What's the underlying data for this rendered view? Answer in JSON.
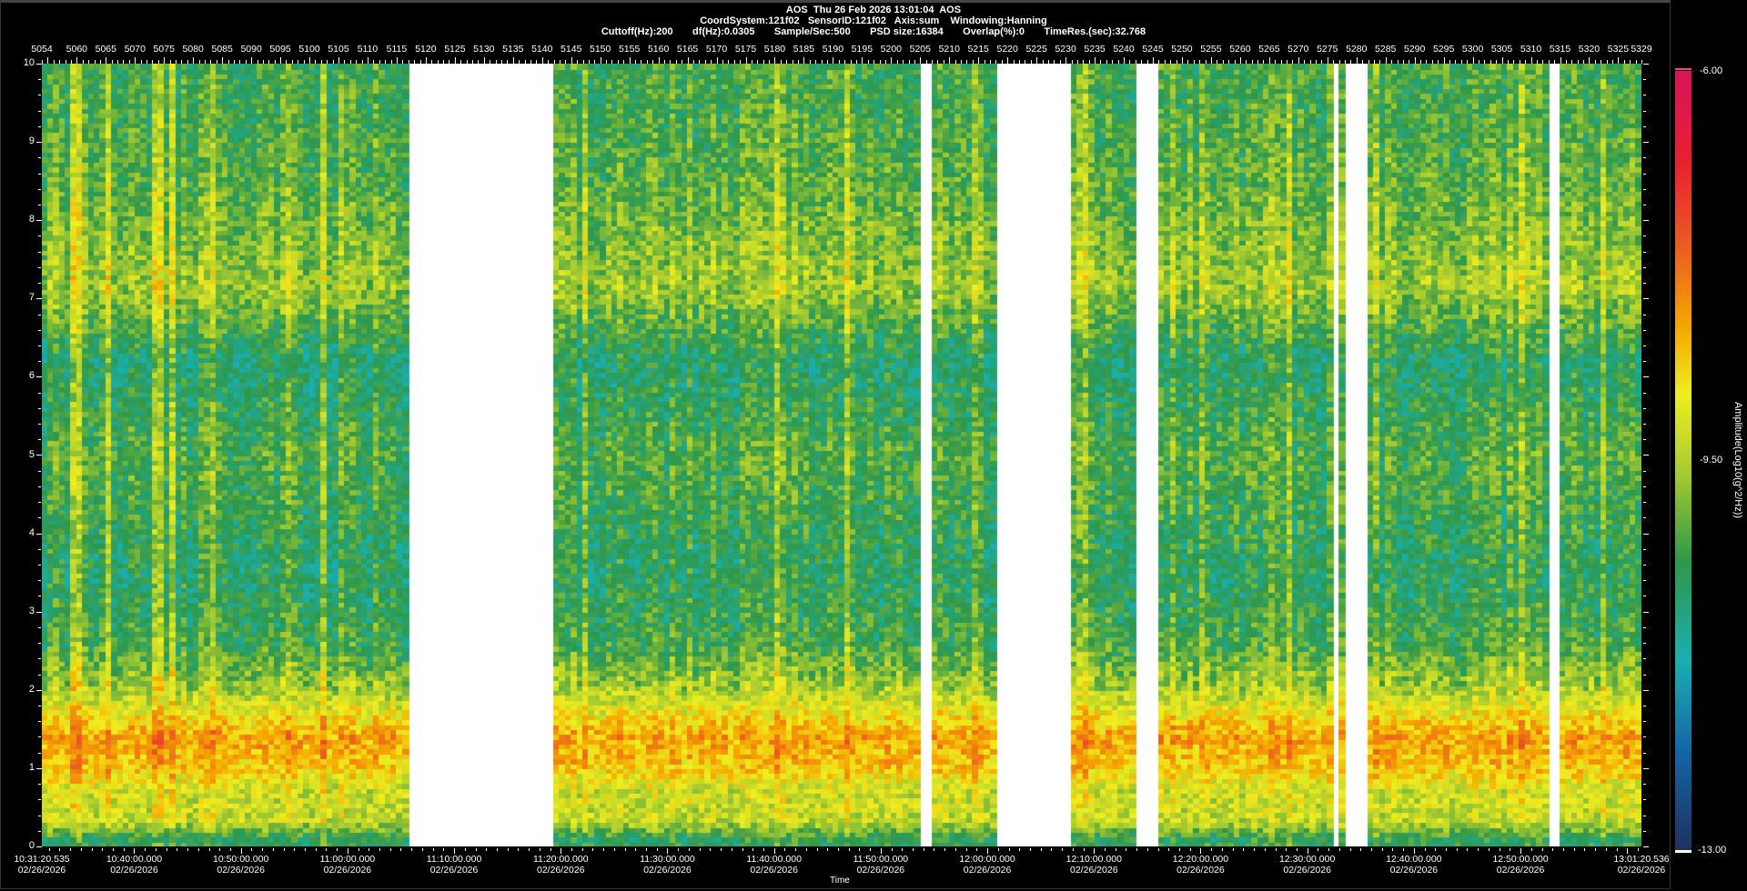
{
  "header": {
    "title": "AOS  Thu 26 Feb 2026 13:01:04  AOS",
    "line2": "CoordSystem:121f02   SensorID:121f02   Axis:sum    Windowing:Hanning",
    "line3": "Cuttoff(Hz):200       df(Hz):0.0305       Sample/Sec:500       PSD size:16384       Overlap(%):0       TimeRes.(sec):32.768"
  },
  "chart_data": {
    "type": "heatmap",
    "xlabel": "Time",
    "ylabel": "",
    "ylim": [
      0,
      10
    ],
    "yticks": [
      "0",
      "1",
      "2",
      "3",
      "4",
      "5",
      "6",
      "7",
      "8",
      "9",
      "10"
    ],
    "x_start": "10:31:20.535",
    "x_end": "13:01:20.536",
    "xticks": [
      {
        "time": "10:31:20.535",
        "date": "02/26/2026"
      },
      {
        "time": "10:40:00.000",
        "date": "02/26/2026"
      },
      {
        "time": "10:50:00.000",
        "date": "02/26/2026"
      },
      {
        "time": "11:00:00.000",
        "date": "02/26/2026"
      },
      {
        "time": "11:10:00.000",
        "date": "02/26/2026"
      },
      {
        "time": "11:20:00.000",
        "date": "02/26/2026"
      },
      {
        "time": "11:30:00.000",
        "date": "02/26/2026"
      },
      {
        "time": "11:40:00.000",
        "date": "02/26/2026"
      },
      {
        "time": "11:50:00.000",
        "date": "02/26/2026"
      },
      {
        "time": "12:00:00.000",
        "date": "02/26/2026"
      },
      {
        "time": "12:10:00.000",
        "date": "02/26/2026"
      },
      {
        "time": "12:20:00.000",
        "date": "02/26/2026"
      },
      {
        "time": "12:30:00.000",
        "date": "02/26/2026"
      },
      {
        "time": "12:40:00.000",
        "date": "02/26/2026"
      },
      {
        "time": "12:50:00.000",
        "date": "02/26/2026"
      },
      {
        "time": "13:01:20.536",
        "date": "02/26/2026"
      }
    ],
    "top_axis": {
      "start": 5054,
      "end": 5329,
      "labels": [
        "5054",
        "5060",
        "5065",
        "5070",
        "5075",
        "5080",
        "5085",
        "5090",
        "5095",
        "5100",
        "5105",
        "5110",
        "5115",
        "5120",
        "5125",
        "5130",
        "5135",
        "5140",
        "5145",
        "5150",
        "5155",
        "5160",
        "5165",
        "5170",
        "5175",
        "5180",
        "5185",
        "5190",
        "5195",
        "5200",
        "5205",
        "5210",
        "5215",
        "5220",
        "5225",
        "5230",
        "5235",
        "5240",
        "5245",
        "5250",
        "5255",
        "5260",
        "5265",
        "5270",
        "5275",
        "5280",
        "5285",
        "5290",
        "5295",
        "5300",
        "5305",
        "5310",
        "5315",
        "5320",
        "5325",
        "5329"
      ]
    },
    "gaps": [
      [
        "11:05:38",
        "11:19:14"
      ],
      [
        "11:53:38",
        "11:54:44"
      ],
      [
        "12:00:56",
        "12:08:14"
      ],
      [
        "12:14:14",
        "12:16:26"
      ],
      [
        "12:32:32",
        "12:32:56"
      ],
      [
        "12:33:50",
        "12:36:02"
      ],
      [
        "12:53:02",
        "12:54:08"
      ]
    ],
    "band_profile": {
      "freq_hz": [
        0.1,
        0.35,
        0.75,
        1.0,
        1.4,
        2.0,
        2.6,
        3.5,
        5.0,
        6.2,
        7.15,
        8.5,
        9.5
      ],
      "mean_amplitude": [
        -10.5,
        -9.3,
        -9.2,
        -8.6,
        -8.2,
        -9.5,
        -10.3,
        -10.6,
        -10.2,
        -10.7,
        -9.6,
        -10.1,
        -10.3
      ]
    },
    "colorbar": {
      "label": "Amplitude(Log10(g^2/Hz))",
      "min": -13.0,
      "max": -6.0,
      "tick_labels": [
        "-6.00",
        "-9.50",
        "-13.00"
      ],
      "colors": [
        {
          "value": -6.0,
          "color": "#d8145e"
        },
        {
          "value": -6.8,
          "color": "#e82030"
        },
        {
          "value": -7.6,
          "color": "#ec6020"
        },
        {
          "value": -8.3,
          "color": "#f5a800"
        },
        {
          "value": -8.9,
          "color": "#f0ee20"
        },
        {
          "value": -9.6,
          "color": "#a8cc30"
        },
        {
          "value": -10.4,
          "color": "#30984a"
        },
        {
          "value": -11.3,
          "color": "#1ab0b0"
        },
        {
          "value": -12.1,
          "color": "#1468a8"
        },
        {
          "value": -13.0,
          "color": "#203060"
        }
      ]
    }
  }
}
